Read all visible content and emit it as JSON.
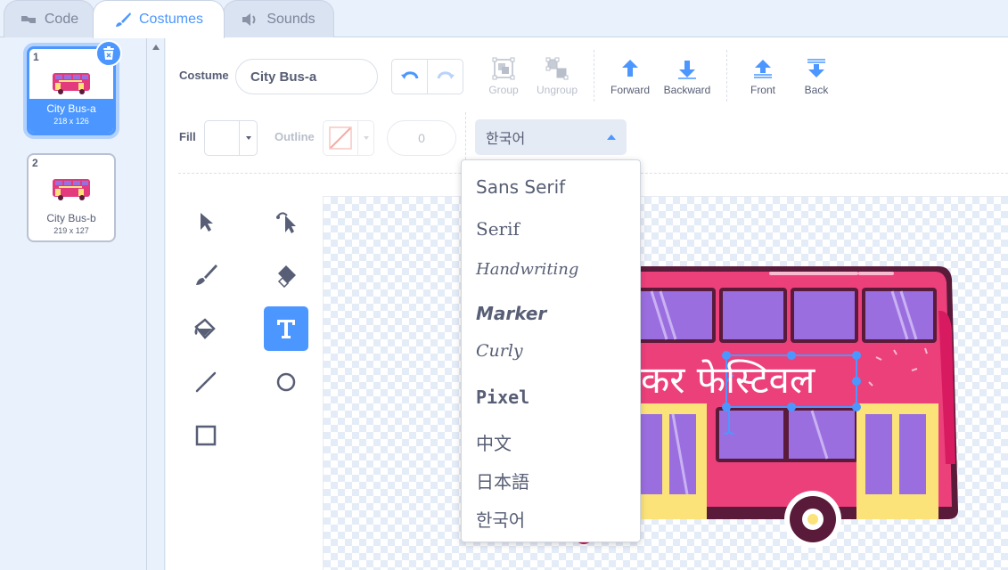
{
  "tabs": [
    {
      "label": "Code",
      "icon": "code-icon"
    },
    {
      "label": "Costumes",
      "icon": "brush-icon"
    },
    {
      "label": "Sounds",
      "icon": "speaker-icon"
    }
  ],
  "costumes": [
    {
      "number": "1",
      "name": "City Bus-a",
      "size": "218 x 126"
    },
    {
      "number": "2",
      "name": "City Bus-b",
      "size": "219 x 127"
    }
  ],
  "toolbar": {
    "costume_label": "Costume",
    "costume_name": "City Bus-a",
    "group": "Group",
    "ungroup": "Ungroup",
    "forward": "Forward",
    "backward": "Backward",
    "front": "Front",
    "back": "Back",
    "fill_label": "Fill",
    "outline_label": "Outline",
    "outline_width": "0",
    "font_selected": "한국어"
  },
  "font_menu": {
    "items": [
      "Sans Serif",
      "Serif",
      "Handwriting",
      "Marker",
      "Curly",
      "Pixel",
      "中文",
      "日本語",
      "한국어"
    ]
  },
  "canvas": {
    "text_content": "कर फेस्टिवल"
  },
  "colors": {
    "accent": "#4c97ff",
    "bus_body": "#ec407a",
    "bus_window": "#9b6ee0",
    "bus_door": "#fbe37a"
  }
}
